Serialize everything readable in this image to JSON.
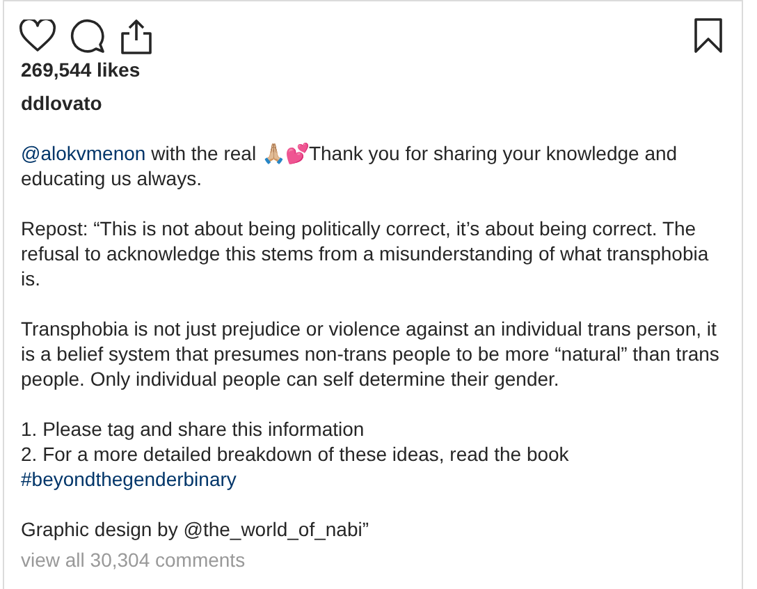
{
  "actions": [
    {
      "kind": "like"
    },
    {
      "kind": "comment"
    },
    {
      "kind": "share"
    },
    {
      "kind": "save"
    }
  ],
  "likes": "269,544 likes",
  "username": "ddlovato",
  "caption": [
    [
      [
        {
          "kind": "mention",
          "text": "@alokvmenon"
        },
        {
          "kind": "plain",
          "text": " with the real 🙏🏼💕Thank you for sharing your knowledge and educating us always."
        }
      ]
    ],
    [
      [
        {
          "kind": "plain",
          "text": "Repost: “This is not about being politically correct, it’s about being correct. The refusal to acknowledge this stems from a misunderstanding of what transphobia is."
        }
      ]
    ],
    [
      [
        {
          "kind": "plain",
          "text": "Transphobia is not just prejudice or violence against an individual trans person, it is a belief system that presumes non-trans people to be more “natural” than trans people. Only individual people can self determine their gender."
        }
      ]
    ],
    [
      [
        {
          "kind": "plain",
          "text": "1. Please tag and share this information"
        }
      ],
      [
        {
          "kind": "plain",
          "text": "2. For a more detailed breakdown of these ideas, read the book"
        }
      ],
      [
        {
          "kind": "hashtag",
          "text": "#beyondthegenderbinary"
        }
      ]
    ],
    [
      [
        {
          "kind": "plain",
          "text": "Graphic design by @the_world_of_nabi”"
        }
      ]
    ]
  ],
  "view_comments": "view all 30,304 comments"
}
